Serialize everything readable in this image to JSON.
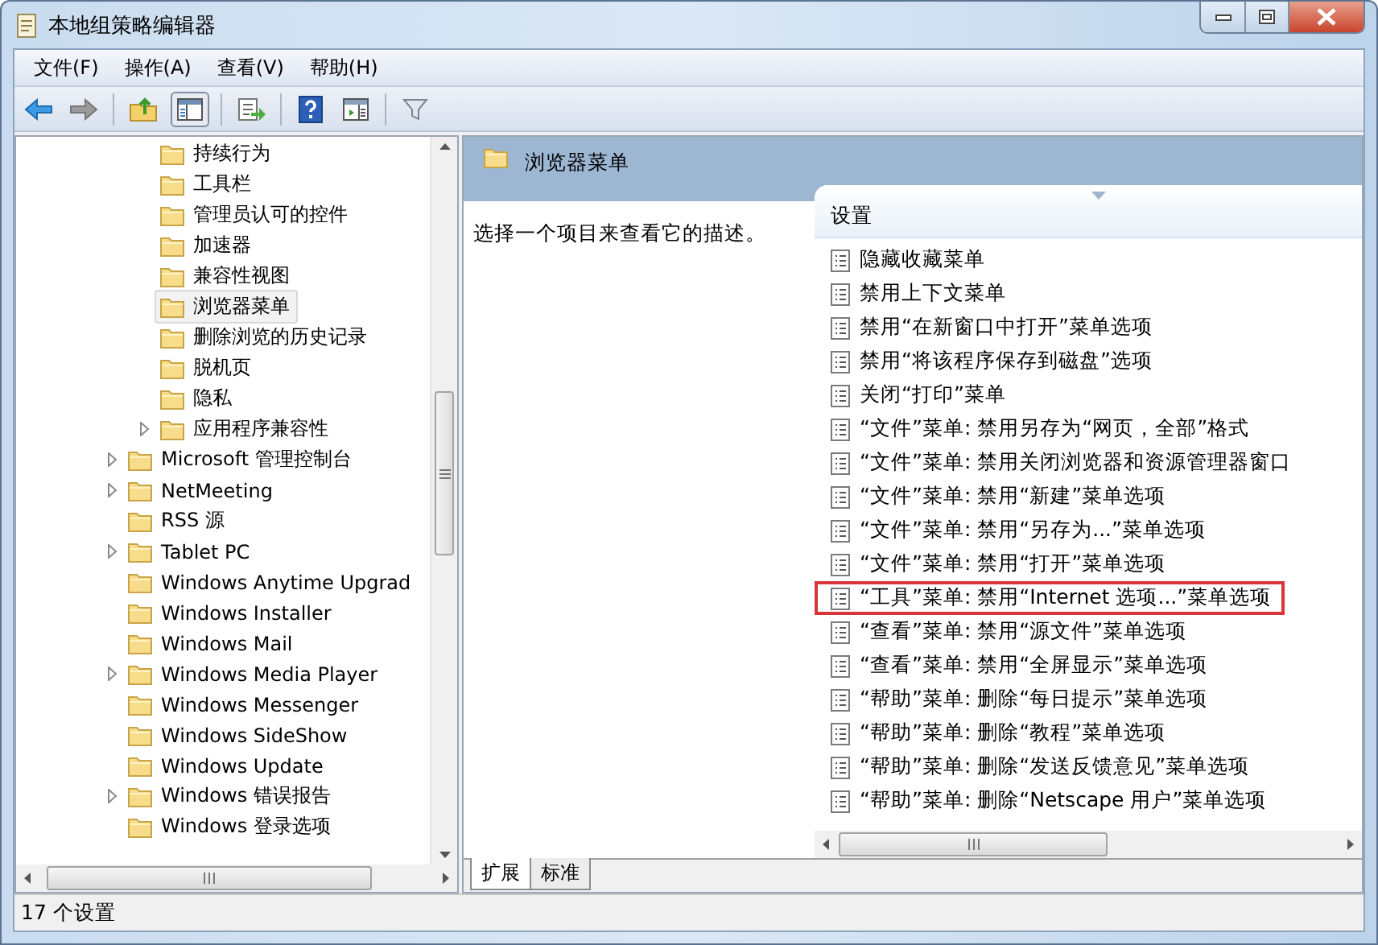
{
  "window": {
    "title": "本地组策略编辑器"
  },
  "menu": [
    "文件(F)",
    "操作(A)",
    "查看(V)",
    "帮助(H)"
  ],
  "tree": {
    "items": [
      {
        "children": [
          {
            "label": "持续行为",
            "expandable": false,
            "selected": false
          },
          {
            "label": "工具栏",
            "expandable": false,
            "selected": false
          },
          {
            "label": "管理员认可的控件",
            "expandable": false,
            "selected": false
          },
          {
            "label": "加速器",
            "expandable": false,
            "selected": false
          },
          {
            "label": "兼容性视图",
            "expandable": false,
            "selected": false
          },
          {
            "label": "浏览器菜单",
            "expandable": false,
            "selected": true
          },
          {
            "label": "删除浏览的历史记录",
            "expandable": false,
            "selected": false
          },
          {
            "label": "脱机页",
            "expandable": false,
            "selected": false
          },
          {
            "label": "隐私",
            "expandable": false,
            "selected": false
          },
          {
            "label": "应用程序兼容性",
            "expandable": true,
            "selected": false
          }
        ]
      },
      {
        "label": "Microsoft 管理控制台",
        "expandable": true,
        "selected": false
      },
      {
        "label": "NetMeeting",
        "expandable": true,
        "selected": false
      },
      {
        "label": "RSS 源",
        "expandable": false,
        "selected": false
      },
      {
        "label": "Tablet PC",
        "expandable": true,
        "selected": false
      },
      {
        "label": "Windows Anytime Upgrad",
        "expandable": false,
        "selected": false
      },
      {
        "label": "Windows Installer",
        "expandable": false,
        "selected": false
      },
      {
        "label": "Windows Mail",
        "expandable": false,
        "selected": false
      },
      {
        "label": "Windows Media Player",
        "expandable": true,
        "selected": false
      },
      {
        "label": "Windows Messenger",
        "expandable": false,
        "selected": false
      },
      {
        "label": "Windows SideShow",
        "expandable": false,
        "selected": false
      },
      {
        "label": "Windows Update",
        "expandable": false,
        "selected": false
      },
      {
        "label": "Windows 错误报告",
        "expandable": true,
        "selected": false
      },
      {
        "label": "Windows 登录选项",
        "expandable": false,
        "selected": false
      }
    ]
  },
  "details": {
    "heading": "浏览器菜单",
    "description": "选择一个项目来查看它的描述。",
    "column": "设置",
    "settings": [
      {
        "label": "隐藏收藏菜单",
        "highlighted": false
      },
      {
        "label": "禁用上下文菜单",
        "highlighted": false
      },
      {
        "label": "禁用“在新窗口中打开”菜单选项",
        "highlighted": false
      },
      {
        "label": "禁用“将该程序保存到磁盘”选项",
        "highlighted": false
      },
      {
        "label": "关闭“打印”菜单",
        "highlighted": false
      },
      {
        "label": "“文件”菜单: 禁用另存为“网页，全部”格式",
        "highlighted": false
      },
      {
        "label": "“文件”菜单: 禁用关闭浏览器和资源管理器窗口",
        "highlighted": false
      },
      {
        "label": "“文件”菜单: 禁用“新建”菜单选项",
        "highlighted": false
      },
      {
        "label": "“文件”菜单: 禁用“另存为...”菜单选项",
        "highlighted": false
      },
      {
        "label": "“文件”菜单: 禁用“打开”菜单选项",
        "highlighted": false
      },
      {
        "label": "“工具”菜单: 禁用“Internet 选项...”菜单选项",
        "highlighted": true
      },
      {
        "label": "“查看”菜单: 禁用“源文件”菜单选项",
        "highlighted": false
      },
      {
        "label": "“查看”菜单: 禁用“全屏显示”菜单选项",
        "highlighted": false
      },
      {
        "label": "“帮助”菜单: 删除“每日提示”菜单选项",
        "highlighted": false
      },
      {
        "label": "“帮助”菜单: 删除“教程”菜单选项",
        "highlighted": false
      },
      {
        "label": "“帮助”菜单: 删除“发送反馈意见”菜单选项",
        "highlighted": false
      },
      {
        "label": "“帮助”菜单: 删除“Netscape 用户”菜单选项",
        "highlighted": false
      }
    ],
    "tabs": [
      {
        "label": "扩展",
        "selected": true
      },
      {
        "label": "标准",
        "selected": false
      }
    ]
  },
  "status_bar": "17 个设置"
}
